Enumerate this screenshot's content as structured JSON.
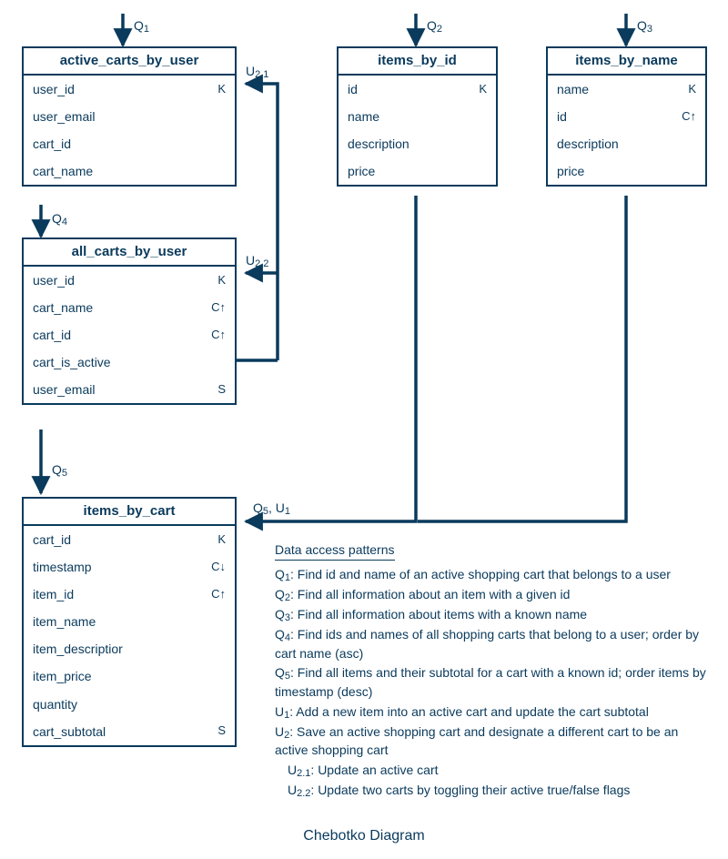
{
  "caption": "Chebotko Diagram",
  "labels": {
    "q1": "Q",
    "q1s": "1",
    "q2": "Q",
    "q2s": "2",
    "q3": "Q",
    "q3s": "3",
    "q4": "Q",
    "q4s": "4",
    "q5": "Q",
    "q5s": "5",
    "u21": "U",
    "u21s": "2.1",
    "u22": "U",
    "u22s": "2.2",
    "q5u1_a": "Q",
    "q5u1_as": "5",
    "q5u1_sep": ", ",
    "q5u1_b": "U",
    "q5u1_bs": "1"
  },
  "tables": {
    "t1": {
      "title": "active_carts_by_user",
      "rows": [
        {
          "name": "user_id",
          "key": "K"
        },
        {
          "name": "user_email",
          "key": ""
        },
        {
          "name": "cart_id",
          "key": ""
        },
        {
          "name": "cart_name",
          "key": ""
        }
      ]
    },
    "t2": {
      "title": "items_by_id",
      "rows": [
        {
          "name": "id",
          "key": "K"
        },
        {
          "name": "name",
          "key": ""
        },
        {
          "name": "description",
          "key": ""
        },
        {
          "name": "price",
          "key": ""
        }
      ]
    },
    "t3": {
      "title": "items_by_name",
      "rows": [
        {
          "name": "name",
          "key": "K"
        },
        {
          "name": "id",
          "key": "C↑"
        },
        {
          "name": "description",
          "key": ""
        },
        {
          "name": "price",
          "key": ""
        }
      ]
    },
    "t4": {
      "title": "all_carts_by_user",
      "rows": [
        {
          "name": "user_id",
          "key": "K"
        },
        {
          "name": "cart_name",
          "key": "C↑"
        },
        {
          "name": "cart_id",
          "key": "C↑"
        },
        {
          "name": "cart_is_active",
          "key": ""
        },
        {
          "name": "user_email",
          "key": "S"
        }
      ]
    },
    "t5": {
      "title": "items_by_cart",
      "rows": [
        {
          "name": "cart_id",
          "key": "K"
        },
        {
          "name": "timestamp",
          "key": "C↓"
        },
        {
          "name": "item_id",
          "key": "C↑"
        },
        {
          "name": "item_name",
          "key": ""
        },
        {
          "name": "item_descriptior",
          "key": ""
        },
        {
          "name": "item_price",
          "key": ""
        },
        {
          "name": "quantity",
          "key": ""
        },
        {
          "name": "cart_subtotal",
          "key": "S"
        }
      ]
    }
  },
  "notes": {
    "heading": "Data access patterns",
    "items": [
      {
        "label": "Q",
        "sub": "1",
        "text": ": Find id and name of an active shopping cart that belongs to a user"
      },
      {
        "label": "Q",
        "sub": "2",
        "text": ": Find all information about an item with a given id"
      },
      {
        "label": "Q",
        "sub": "3",
        "text": ": Find all information about items with a known name"
      },
      {
        "label": "Q",
        "sub": "4",
        "text": ": Find ids and names of all shopping carts that belong to a user; order by cart name (asc)"
      },
      {
        "label": "Q",
        "sub": "5",
        "text": ": Find all items and their subtotal for a cart with a known id; order items by timestamp (desc)"
      },
      {
        "label": "U",
        "sub": "1",
        "text": ": Add a new item into an active cart and update the cart subtotal"
      },
      {
        "label": "U",
        "sub": "2",
        "text": ": Save an active shopping cart and designate a different cart to be an active shopping cart"
      },
      {
        "label": "U",
        "sub": "2.1",
        "text": ": Update an active cart",
        "indent": true
      },
      {
        "label": "U",
        "sub": "2.2",
        "text": ": Update two carts by toggling their active true/false flags",
        "indent": true
      }
    ]
  }
}
